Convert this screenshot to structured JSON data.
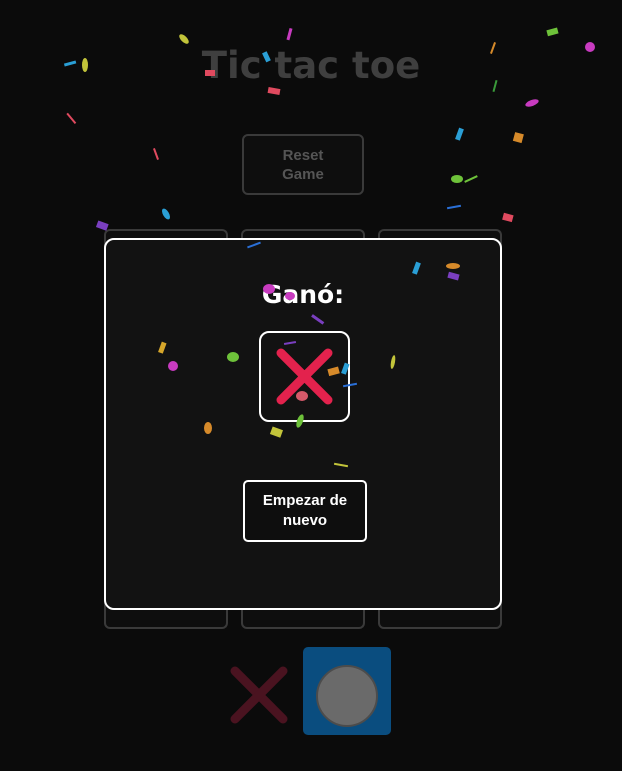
{
  "game": {
    "title": "Tic tac toe",
    "reset_label": "Reset Game",
    "turn_indicator": {
      "x_symbol": "cross-icon",
      "o_symbol": "circle-icon",
      "active": "o"
    }
  },
  "modal": {
    "title": "Ganó:",
    "winner": "X",
    "restart_label": "Empezar de nuevo"
  },
  "colors": {
    "x_mark": "#e3224d",
    "x_mark_dim": "#4a1320",
    "o_active_bg": "#0a4d7f",
    "background": "#0b0b0b"
  }
}
